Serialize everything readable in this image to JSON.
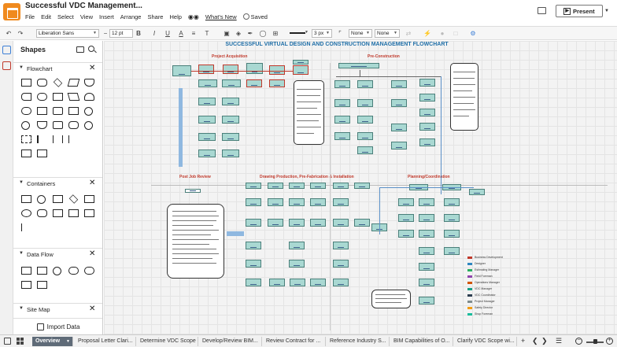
{
  "app": {
    "document_title": "Successful VDC Management...",
    "menus": [
      "File",
      "Edit",
      "Select",
      "View",
      "Insert",
      "Arrange",
      "Share",
      "Help"
    ],
    "whats_new": "What's New",
    "saved": "Saved",
    "present_label": "Present"
  },
  "toolbar": {
    "font_name": "Liberation Sans",
    "font_size": "12 pt",
    "bold": "B",
    "italic": "I",
    "underline": "U",
    "text_color": "A",
    "line_width": "3 px",
    "start_arrow": "None",
    "end_arrow": "None"
  },
  "sidebar": {
    "title": "Shapes",
    "sections": [
      "Flowchart",
      "Containers",
      "Data Flow",
      "Site Map"
    ],
    "import_label": "Import Data"
  },
  "canvas": {
    "chart_title": "SUCCESSFUL VIRTUAL DESIGN AND CONSTRUCTION MANAGEMENT FLOWCHART",
    "section_labels": {
      "project_acquisition": "Project Acquisition",
      "pre_construction": "Pre-Construction",
      "post_job_review": "Post Job Review",
      "drawing_production": "Drawing Production, Pre-Fabrication & Installation",
      "planning_coordination": "Planning/Coordination"
    },
    "legend": [
      {
        "label": "Business Development",
        "color": "#c0392b"
      },
      {
        "label": "Designer",
        "color": "#2e86c1"
      },
      {
        "label": "Estimating Manager",
        "color": "#27ae60"
      },
      {
        "label": "Field Foreman",
        "color": "#8e44ad"
      },
      {
        "label": "Operations Manager",
        "color": "#d35400"
      },
      {
        "label": "VDC Manager",
        "color": "#16a085"
      },
      {
        "label": "VDC Coordinator",
        "color": "#2c3e50"
      },
      {
        "label": "Project Manager",
        "color": "#7f8c8d"
      },
      {
        "label": "Safety Director",
        "color": "#f39c12"
      },
      {
        "label": "Shop Foreman",
        "color": "#1abc9c"
      }
    ]
  },
  "pages": {
    "tabs": [
      "Overview",
      "Proposal Letter Clari...",
      "Determine VDC Scope",
      "Develop/Review BIM...",
      "Review Contract for ...",
      "Reference Industry S...",
      "BIM Capabilities of O...",
      "Clarify VDC Scope wi..."
    ]
  }
}
